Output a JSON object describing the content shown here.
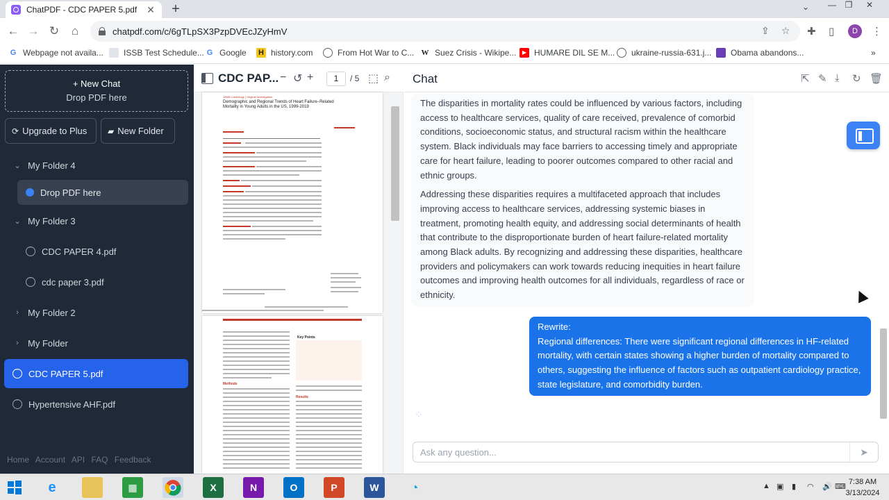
{
  "browser": {
    "tab_title": "ChatPDF - CDC PAPER 5.pdf",
    "url": "chatpdf.com/c/6gTLpSX3PzpDVEcJZyHmV",
    "profile_initial": "D",
    "bookmarks": [
      {
        "label": "Webpage not availa...",
        "icon": "google-g-icon"
      },
      {
        "label": "ISSB Test Schedule...",
        "icon": "site-icon"
      },
      {
        "label": "Google",
        "icon": "google-g-icon"
      },
      {
        "label": "history.com",
        "icon": "history-h-icon"
      },
      {
        "label": "From Hot War to C...",
        "icon": "globe-icon"
      },
      {
        "label": "Suez Crisis - Wikipe...",
        "icon": "wikipedia-icon"
      },
      {
        "label": "HUMARE DIL SE M...",
        "icon": "youtube-icon"
      },
      {
        "label": "ukraine-russia-631.j...",
        "icon": "globe-icon"
      },
      {
        "label": "Obama abandons...",
        "icon": "site-icon"
      }
    ]
  },
  "sidebar": {
    "new_chat_label": "+ New Chat",
    "drop_label": "Drop PDF here",
    "upgrade_label": "Upgrade to Plus",
    "new_folder_label": "New Folder",
    "items": [
      {
        "label": "My Folder 4",
        "kind": "folder-open"
      },
      {
        "label": "Drop PDF here",
        "kind": "drop"
      },
      {
        "label": "My Folder 3",
        "kind": "folder-open"
      },
      {
        "label": "CDC PAPER 4.pdf",
        "kind": "chat"
      },
      {
        "label": "cdc paper 3.pdf",
        "kind": "chat"
      },
      {
        "label": "My Folder 2",
        "kind": "folder-closed"
      },
      {
        "label": "My Folder",
        "kind": "folder-closed"
      },
      {
        "label": "CDC PAPER 5.pdf",
        "kind": "chat-active"
      },
      {
        "label": "Hypertensive AHF.pdf",
        "kind": "chat"
      }
    ],
    "footer": [
      "Home",
      "Account",
      "API",
      "FAQ",
      "Feedback"
    ]
  },
  "pdf": {
    "title": "CDC PAP...",
    "current_page": "1",
    "total_pages": "/ 5",
    "page1_heading": "Demographic and Regional Trends of Heart Failure–Related Mortality in Young Adults in the US, 1999-2019",
    "page1_journal": "JAMA Cardiology | Original Investigation",
    "page2_section_methods": "Methods",
    "page2_section_results": "Results",
    "page2_section_keypoints": "Key Points"
  },
  "chat": {
    "title": "Chat",
    "bot_message": [
      "The disparities in mortality rates could be influenced by various factors, including access to healthcare services, quality of care received, prevalence of comorbid conditions, socioeconomic status, and structural racism within the healthcare system. Black individuals may face barriers to accessing timely and appropriate care for heart failure, leading to poorer outcomes compared to other racial and ethnic groups.",
      "Addressing these disparities requires a multifaceted approach that includes improving access to healthcare services, addressing systemic biases in treatment, promoting health equity, and addressing social determinants of health that contribute to the disproportionate burden of heart failure-related mortality among Black adults. By recognizing and addressing these disparities, healthcare providers and policymakers can work towards reducing inequities in heart failure outcomes and improving health outcomes for all individuals, regardless of race or ethnicity."
    ],
    "user_message_line1": "Rewrite:",
    "user_message_line2": "Regional differences: There were significant regional differences in HF-related mortality, with certain states showing a higher burden of mortality compared to others, suggesting the influence of factors such as outpatient cardiology practice, state legislature, and comorbidity burden.",
    "input_placeholder": "Ask any question..."
  },
  "taskbar": {
    "time": "7:38 AM",
    "date": "3/13/2024"
  },
  "colors": {
    "sidebar_bg": "#1f2937",
    "accent_blue": "#2563eb",
    "user_bubble": "#1a73e8"
  }
}
